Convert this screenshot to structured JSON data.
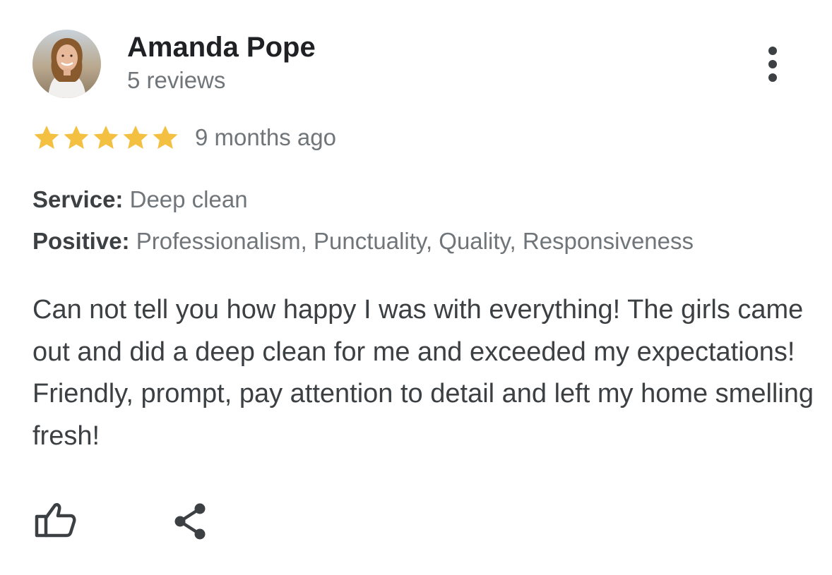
{
  "review": {
    "author_name": "Amanda Pope",
    "review_count": "5 reviews",
    "rating": 5,
    "rating_max": 5,
    "time_ago": "9 months ago",
    "service_label": "Service:",
    "service_value": "Deep clean",
    "positive_label": "Positive:",
    "positive_value": "Professionalism, Punctuality, Quality, Responsiveness",
    "text": "Can not tell you how happy I was with everything! The girls came out and did a deep clean for me and exceeded my expectations! Friendly, prompt, pay attention to detail and left my home smelling fresh!"
  },
  "icons": {
    "more": "more-vert-icon",
    "star": "star-icon",
    "like": "thumbs-up-icon",
    "share": "share-icon"
  },
  "colors": {
    "star": "#f4c041",
    "name": "#202124",
    "secondary": "#70757a",
    "body": "#3c4043",
    "icon": "#3c4043"
  }
}
